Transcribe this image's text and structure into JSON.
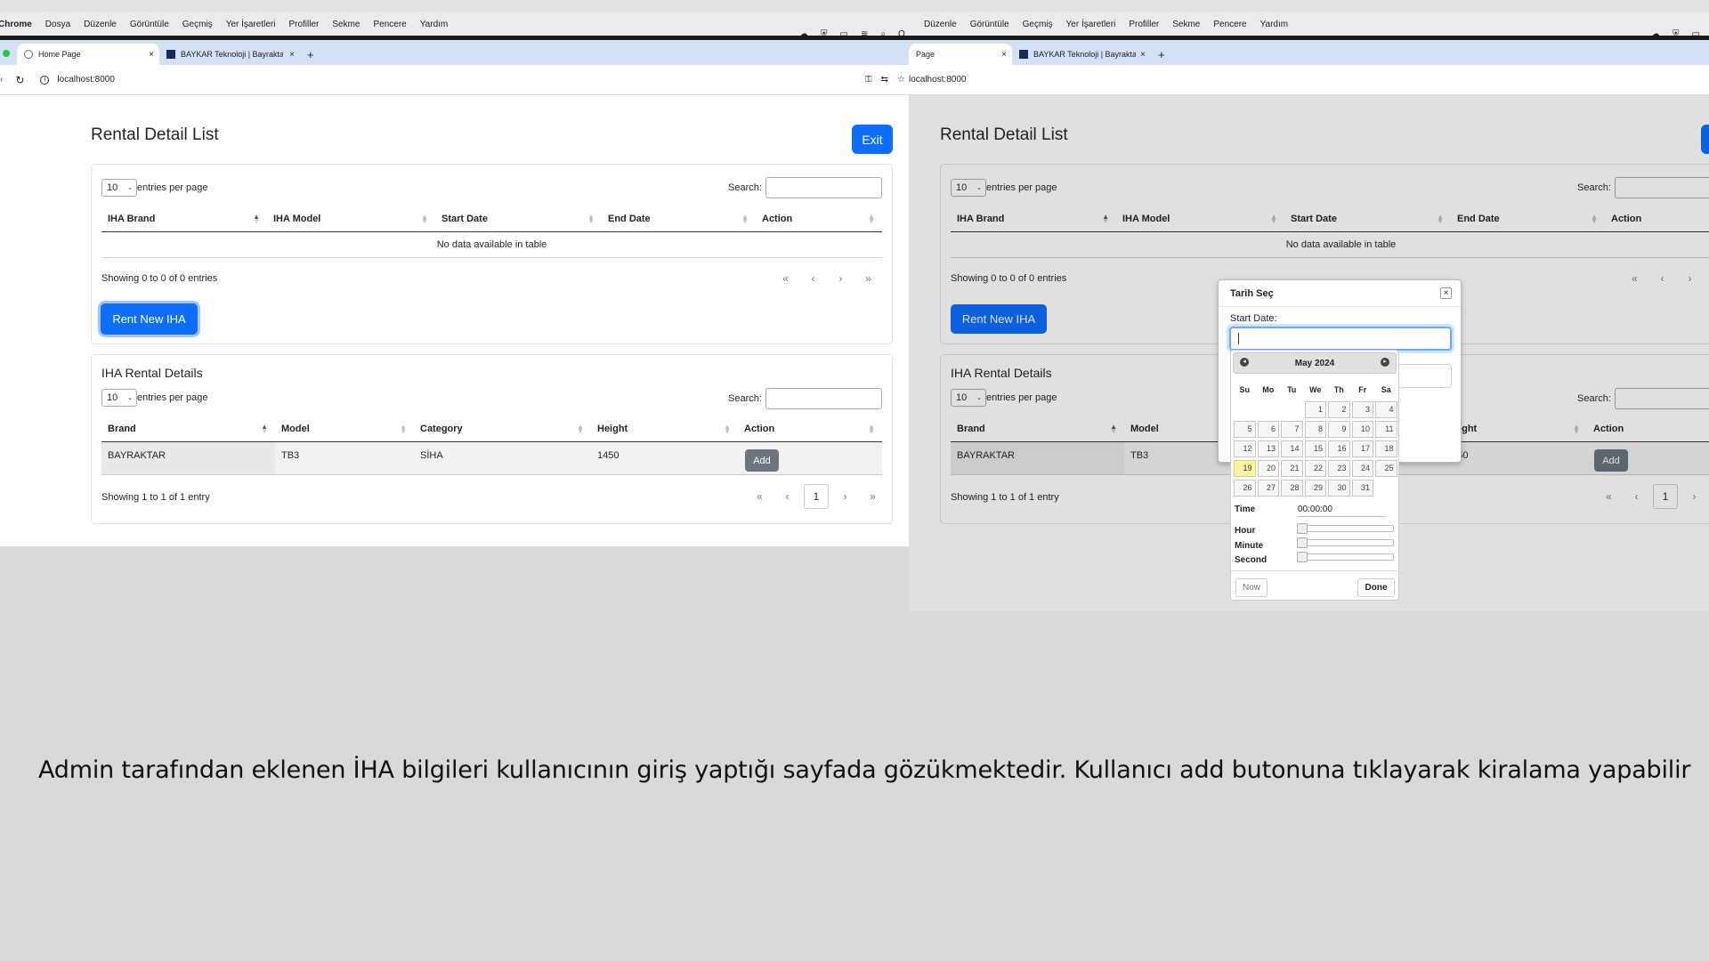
{
  "menubar": {
    "items": [
      "Chrome",
      "Dosya",
      "Düzenle",
      "Görüntüle",
      "Geçmiş",
      "Yer İşaretleri",
      "Profiller",
      "Sekme",
      "Pencere",
      "Yardım"
    ],
    "items_right": [
      "Düzenle",
      "Görüntüle",
      "Geçmiş",
      "Yer İşaretleri",
      "Profiller",
      "Sekme",
      "Pencere",
      "Yardım"
    ]
  },
  "tabs": {
    "left": [
      {
        "title": "Home Page",
        "close": "×"
      },
      {
        "title": "BAYKAR Teknoloji | Bayraktar",
        "close": "×"
      }
    ],
    "right": [
      {
        "title": "Page",
        "close": "×"
      },
      {
        "title": "BAYKAR Teknoloji | Bayraktar",
        "close": "×"
      }
    ],
    "new_tab": "+"
  },
  "address": {
    "url": "localhost:8000"
  },
  "page": {
    "title": "Rental Detail List",
    "exit_label": "Exit",
    "entries_value": "10",
    "entries_label": "entries per page",
    "search_label": "Search:",
    "rental_table": {
      "headers": [
        "IHA Brand",
        "IHA Model",
        "Start Date",
        "End Date",
        "Action"
      ],
      "empty": "No data available in table",
      "info": "Showing 0 to 0 of 0 entries"
    },
    "rent_button": "Rent New IHA",
    "iha_section_title": "IHA Rental Details",
    "iha_table": {
      "headers": [
        "Brand",
        "Model",
        "Category",
        "Height",
        "Action"
      ],
      "rows": [
        {
          "brand": "BAYRAKTAR",
          "model": "TB3",
          "category": "SİHA",
          "height": "1450",
          "action": "Add"
        }
      ],
      "info": "Showing 1 to 1 of 1 entry"
    },
    "pager": {
      "first": "«",
      "prev": "‹",
      "next": "›",
      "last": "»",
      "current": "1"
    }
  },
  "dialog": {
    "title": "Tarih Seç",
    "close": "×",
    "start_label": "Start Date:",
    "calendar": {
      "month": "May 2024",
      "weekdays": [
        "Su",
        "Mo",
        "Tu",
        "We",
        "Th",
        "Fr",
        "Sa"
      ],
      "weeks": [
        [
          "",
          "",
          "",
          "1",
          "2",
          "3",
          "4"
        ],
        [
          "5",
          "6",
          "7",
          "8",
          "9",
          "10",
          "11"
        ],
        [
          "12",
          "13",
          "14",
          "15",
          "16",
          "17",
          "18"
        ],
        [
          "19",
          "20",
          "21",
          "22",
          "23",
          "24",
          "25"
        ],
        [
          "26",
          "27",
          "28",
          "29",
          "30",
          "31",
          ""
        ]
      ],
      "today": "19",
      "time_label": "Time",
      "time_value": "00:00:00",
      "hour_label": "Hour",
      "minute_label": "Minute",
      "second_label": "Second",
      "now_label": "Now",
      "done_label": "Done"
    }
  },
  "caption": "Admin tarafından eklenen İHA bilgileri kullanıcının giriş yaptığı sayfada gözükmektedir. Kullanıcı add butonuna tıklayarak kiralama yapabilir",
  "colors": {
    "primary": "#0d6efd",
    "secondary": "#6c757d",
    "today_highlight": "#fff3a3"
  }
}
